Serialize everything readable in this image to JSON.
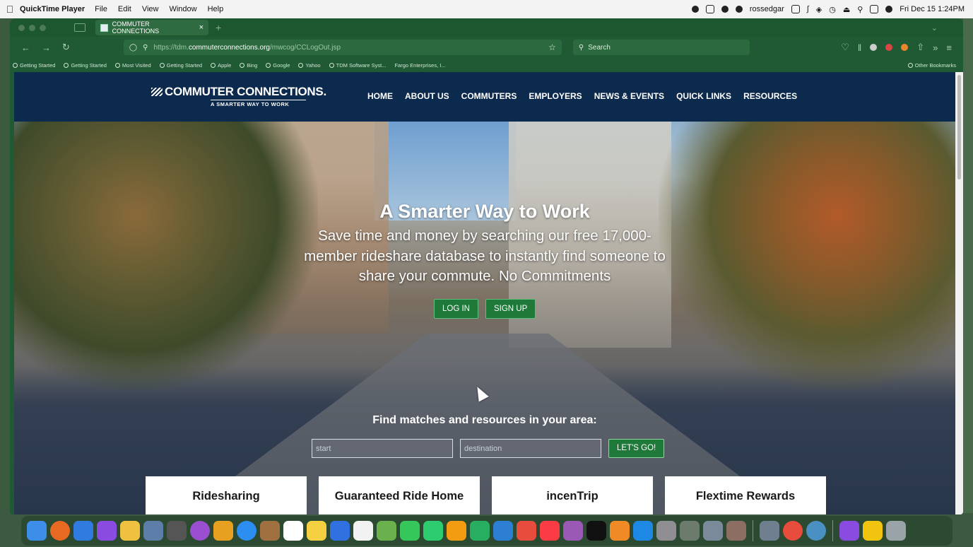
{
  "menubar": {
    "app_name": "QuickTime Player",
    "menus": [
      "File",
      "Edit",
      "View",
      "Window",
      "Help"
    ],
    "user": "rossedgar",
    "datetime": "Fri Dec 15  1:24PM"
  },
  "browser": {
    "tab_title": "COMMUTER CONNECTIONS",
    "tab_close": "×",
    "new_tab": "+",
    "url_prefix": "https://tdm.",
    "url_domain": "commuterconnections.org",
    "url_path": "/mwcog/CCLogOut.jsp",
    "search_placeholder": "Search",
    "bookmarks": [
      "Getting Started",
      "Getting Started",
      "Most Visited",
      "Getting Started",
      "Apple",
      "Bing",
      "Google",
      "Yahoo",
      "TDM Software Syst...",
      "Fargo Enterprises, I..."
    ],
    "other_bookmarks": "Other Bookmarks"
  },
  "site": {
    "logo_text": "COMMUTER CONNECTIONS.",
    "logo_tagline": "A SMARTER WAY TO WORK",
    "nav": [
      "HOME",
      "ABOUT US",
      "COMMUTERS",
      "EMPLOYERS",
      "NEWS & EVENTS",
      "QUICK LINKS",
      "RESOURCES"
    ],
    "hero_title": "A Smarter Way to Work",
    "hero_subtitle": "Save time and money by searching our free 17,000-member rideshare database to instantly find someone to share your commute. No Commitments",
    "login_label": "LOG IN",
    "signup_label": "SIGN UP",
    "find_title": "Find matches and resources in your area:",
    "start_placeholder": "start",
    "destination_placeholder": "destination",
    "go_label": "LET'S GO!",
    "cards": [
      "Ridesharing",
      "Guaranteed Ride Home",
      "incenTrip",
      "Flextime Rewards"
    ]
  },
  "colors": {
    "header_bg": "#0c2a4e",
    "button_green": "#1f7a3a",
    "browser_chrome": "#1f5a34"
  }
}
